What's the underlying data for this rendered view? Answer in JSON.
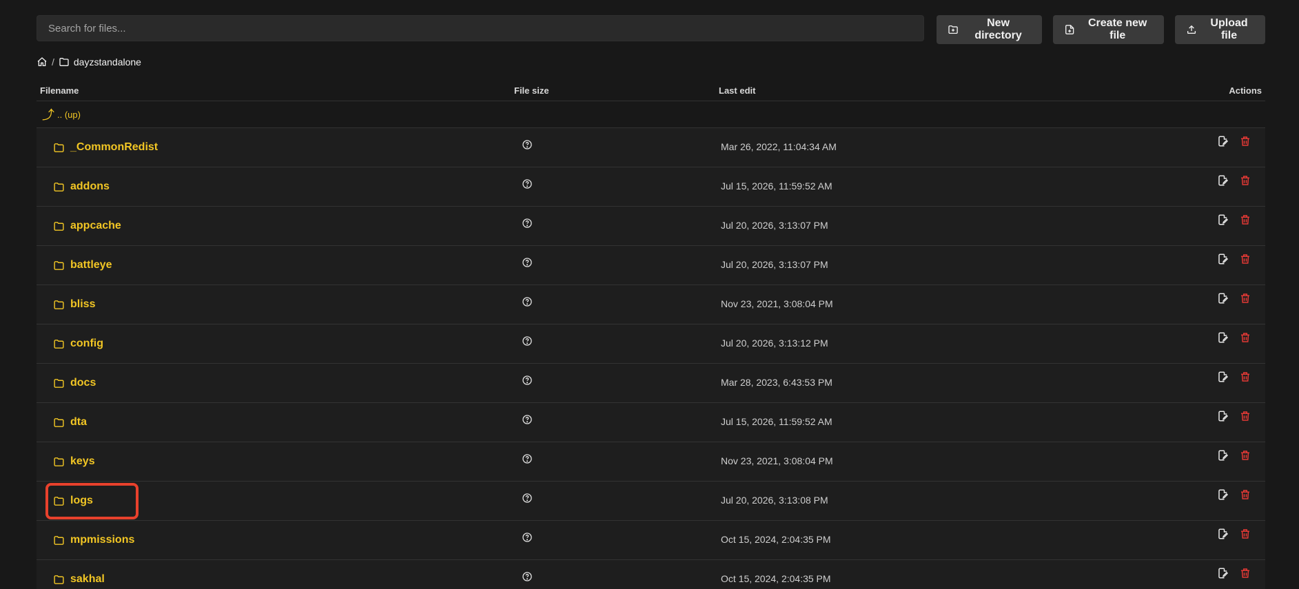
{
  "search": {
    "placeholder": "Search for files..."
  },
  "toolbar": {
    "new_directory": "New directory",
    "create_new_file": "Create new file",
    "upload_file": "Upload file"
  },
  "breadcrumb": {
    "separator": "/",
    "current": "dayzstandalone"
  },
  "table": {
    "headers": {
      "filename": "Filename",
      "file_size": "File size",
      "last_edit": "Last edit",
      "actions": "Actions"
    },
    "up_label": ".. (up)",
    "rows": [
      {
        "name": "_CommonRedist",
        "last_edit": "Mar 26, 2022, 11:04:34 AM"
      },
      {
        "name": "addons",
        "last_edit": "Jul 15, 2026, 11:59:52 AM"
      },
      {
        "name": "appcache",
        "last_edit": "Jul 20, 2026, 3:13:07 PM"
      },
      {
        "name": "battleye",
        "last_edit": "Jul 20, 2026, 3:13:07 PM"
      },
      {
        "name": "bliss",
        "last_edit": "Nov 23, 2021, 3:08:04 PM"
      },
      {
        "name": "config",
        "last_edit": "Jul 20, 2026, 3:13:12 PM"
      },
      {
        "name": "docs",
        "last_edit": "Mar 28, 2023, 6:43:53 PM"
      },
      {
        "name": "dta",
        "last_edit": "Jul 15, 2026, 11:59:52 AM"
      },
      {
        "name": "keys",
        "last_edit": "Nov 23, 2021, 3:08:04 PM"
      },
      {
        "name": "logs",
        "last_edit": "Jul 20, 2026, 3:13:08 PM"
      },
      {
        "name": "mpmissions",
        "last_edit": "Oct 15, 2024, 2:04:35 PM"
      },
      {
        "name": "sakhal",
        "last_edit": "Oct 15, 2024, 2:04:35 PM"
      }
    ]
  },
  "colors": {
    "accent": "#f2c624",
    "danger": "#e53935",
    "highlight": "#e8412c",
    "background": "#181818"
  },
  "icons": {
    "folder": "folder-icon",
    "home": "home-icon",
    "size": "question-circle-icon",
    "edit": "edit-icon",
    "delete": "trash-icon",
    "up": "arrow-up-icon"
  }
}
